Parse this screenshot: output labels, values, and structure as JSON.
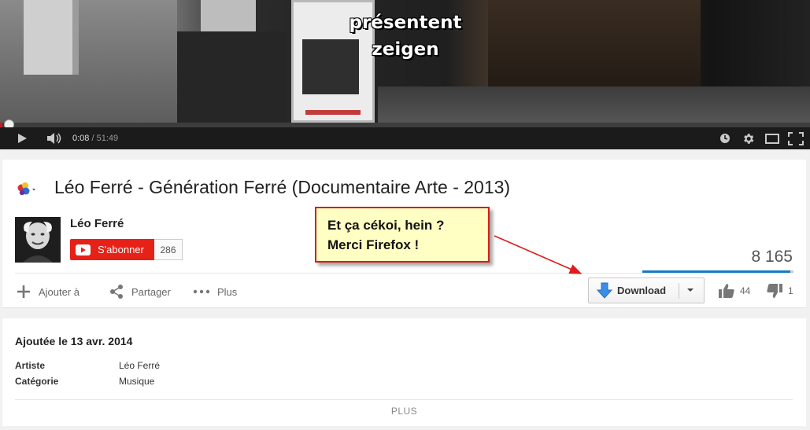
{
  "player": {
    "subtitle_line1": "présentent",
    "subtitle_line2": "zeigen",
    "current_time": "0:08",
    "time_separator": " / ",
    "duration": "51:49",
    "progress_fraction": 0.0026,
    "icons": [
      "play-icon",
      "volume-icon",
      "watch-later-icon",
      "gear-icon",
      "theater-mode-icon",
      "fullscreen-icon"
    ]
  },
  "video": {
    "title": "Léo Ferré - Génération Ferré (Documentaire Arte - 2013)",
    "channel": {
      "name": "Léo Ferré",
      "subscribe_label": "S'abonner",
      "subscriber_count": "286"
    },
    "view_count": "8 165",
    "like_fraction": 0.98,
    "actions": {
      "add_to_label": "Ajouter à",
      "share_label": "Partager",
      "more_label": "Plus",
      "download_label": "Download",
      "likes": "44",
      "dislikes": "1"
    }
  },
  "annotation": {
    "line1": "Et ça cékoi, hein ?",
    "line2": "Merci Firefox !"
  },
  "description": {
    "published": "Ajoutée le 13 avr. 2014",
    "metadata": [
      {
        "key": "Artiste",
        "value": "Léo Ferré"
      },
      {
        "key": "Catégorie",
        "value": "Musique"
      }
    ],
    "show_more_label": "PLUS"
  },
  "colors": {
    "subscribe_red": "#e62117",
    "progress_red": "#cc181e",
    "like_bar_blue": "#167ac6",
    "download_icon_blue": "#3a8ee6",
    "callout_border": "#d0201c",
    "callout_background": "#ffffc4"
  }
}
